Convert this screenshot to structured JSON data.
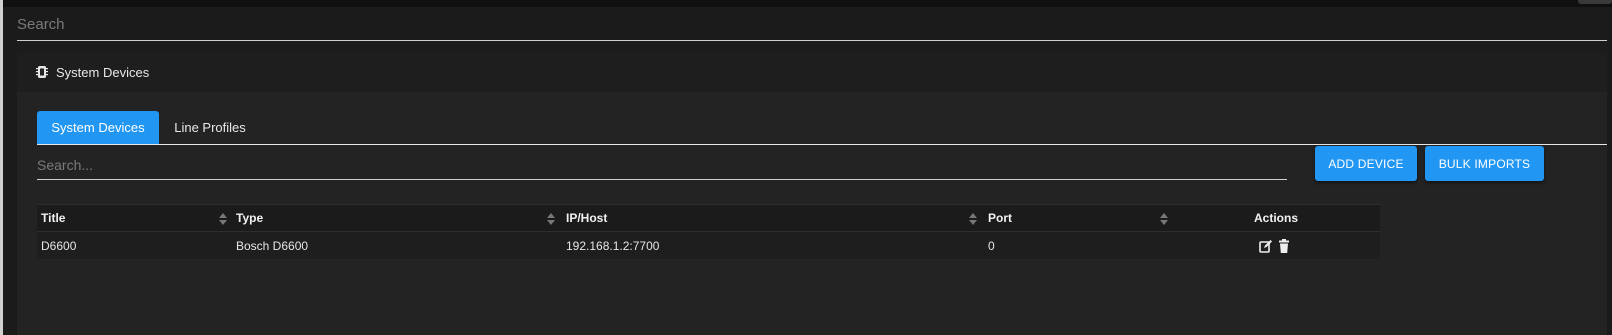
{
  "global_search": {
    "placeholder": "Search"
  },
  "panel": {
    "title": "System Devices",
    "icon": "chip-icon"
  },
  "tabs": [
    {
      "label": "System Devices",
      "active": true
    },
    {
      "label": "Line Profiles",
      "active": false
    }
  ],
  "table_search": {
    "placeholder": "Search..."
  },
  "buttons": {
    "add_device": "ADD DEVICE",
    "bulk_imports": "BULK IMPORTS"
  },
  "table": {
    "columns": [
      "Title",
      "Type",
      "IP/Host",
      "Port",
      "Actions"
    ],
    "rows": [
      {
        "title": "D6600",
        "type": "Bosch D6600",
        "ip_host": "192.168.1.2:7700",
        "port": "0",
        "actions": [
          "edit-icon",
          "trash-icon"
        ]
      }
    ]
  },
  "colors": {
    "accent": "#2196f3",
    "background": "#232323",
    "header_bg": "#1b1b1b"
  }
}
